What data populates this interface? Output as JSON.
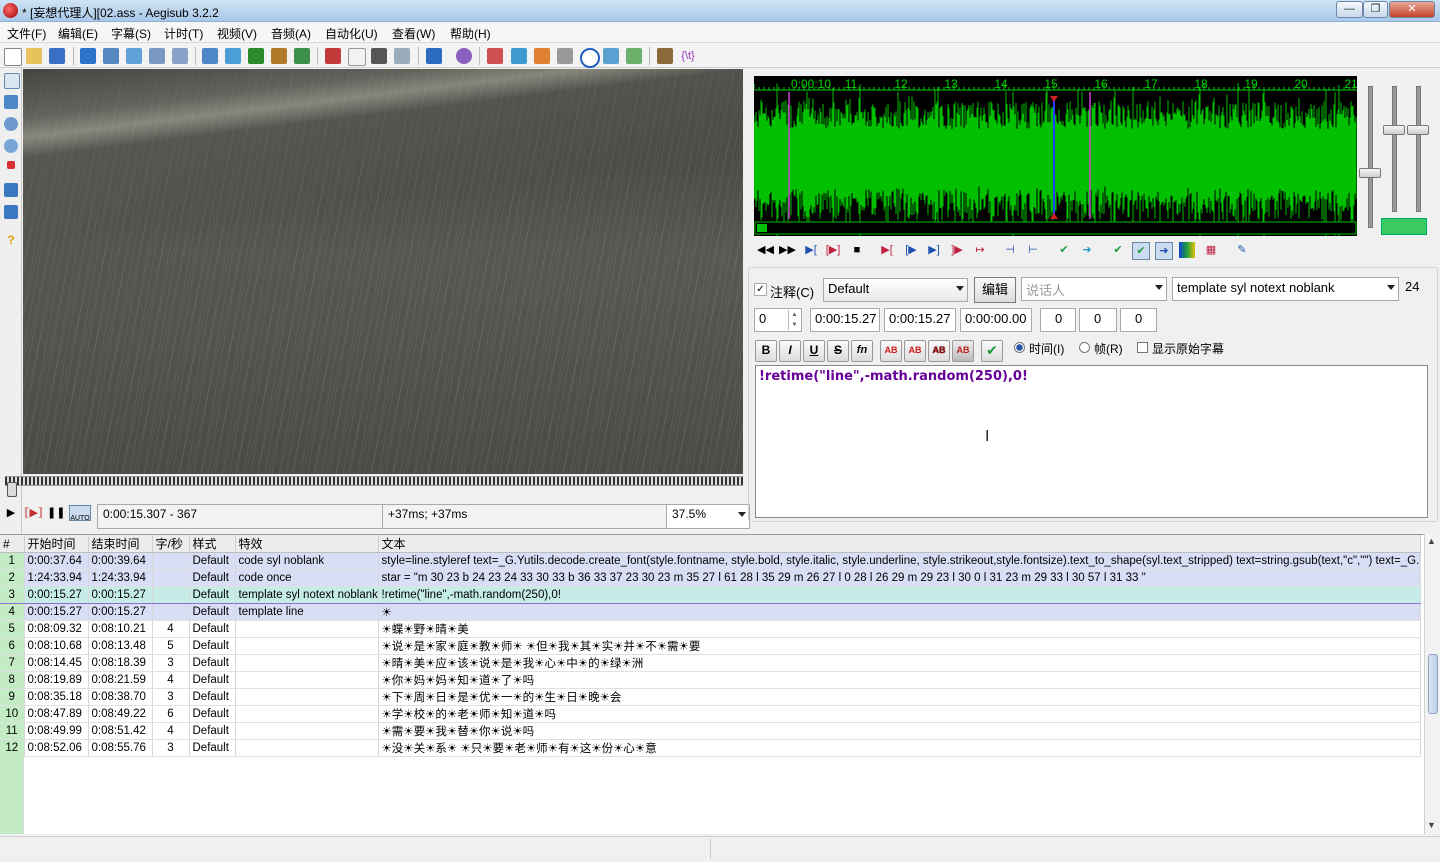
{
  "window": {
    "title": "* [妄想代理人][02.ass - Aegisub 3.2.2",
    "minimize": "—",
    "maximize": "❐",
    "close": "✕"
  },
  "menu": [
    "文件(F)",
    "编辑(E)",
    "字幕(S)",
    "计时(T)",
    "视频(V)",
    "音频(A)",
    "自动化(U)",
    "查看(W)",
    "帮助(H)"
  ],
  "video": {
    "time_frame": "0:00:15.307 - 367",
    "offset": "+37ms; +37ms",
    "zoom": "37.5%",
    "auto_label": "AUTO"
  },
  "audio": {
    "ruler_labels": [
      "0:00:10",
      "11",
      "12",
      "13",
      "14",
      "15",
      "16",
      "17",
      "18",
      "19",
      "20",
      "21"
    ]
  },
  "edit": {
    "comment_label": "注释(C)",
    "style": "Default",
    "edit_button": "编辑",
    "actor_placeholder": "说话人",
    "effect": "template syl notext noblank",
    "fontsize_value": "24",
    "layer": "0",
    "start_time": "0:00:15.27",
    "end_time": "0:00:15.27",
    "duration": "0:00:00.00",
    "margin_l": "0",
    "margin_r": "0",
    "margin_v": "0",
    "time_radio": "时间(I)",
    "frame_radio": "帧(R)",
    "show_original": "显示原始字幕",
    "text": "!retime(\"line\",-math.random(250),0!",
    "format_buttons": [
      "B",
      "I",
      "U",
      "S",
      "fn",
      "AB",
      "AB",
      "AB",
      "AB"
    ]
  },
  "grid": {
    "headers": [
      "#",
      "开始时间",
      "结束时间",
      "字/秒",
      "样式",
      "特效",
      "文本"
    ],
    "rows": [
      {
        "num": "1",
        "start": "0:00:37.64",
        "end": "0:00:39.64",
        "cps": "",
        "style": "Default",
        "effect": "code syl noblank",
        "text": "style=line.styleref text=_G.Yutils.decode.create_font(style.fontname, style.bold, style.italic, style.underline, style.strikeout,style.fontsize).text_to_shape(syl.text_stripped)  text=string.gsub(text,\"c\",\"\")  text=_G.Y",
        "kind": "comment"
      },
      {
        "num": "2",
        "start": "1:24:33.94",
        "end": "1:24:33.94",
        "cps": "",
        "style": "Default",
        "effect": "code once",
        "text": "star = \"m 30 23 b 24 23 24 33 30 33 b 36 33 37 23 30 23 m 35 27 l 61 28 l 35 29 m 26 27 l 0 28 l 26 29 m 29 23 l 30 0 l 31 23 m 29 33 l 30 57 l 31 33 \"",
        "kind": "comment"
      },
      {
        "num": "3",
        "start": "0:00:15.27",
        "end": "0:00:15.27",
        "cps": "",
        "style": "Default",
        "effect": "template syl notext noblank",
        "text": "!retime(\"line\",-math.random(250),0!",
        "kind": "active"
      },
      {
        "num": "4",
        "start": "0:00:15.27",
        "end": "0:00:15.27",
        "cps": "",
        "style": "Default",
        "effect": "template line",
        "text": "☀",
        "kind": "comment"
      },
      {
        "num": "5",
        "start": "0:08:09.32",
        "end": "0:08:10.21",
        "cps": "4",
        "style": "Default",
        "effect": "",
        "text": "☀蝶☀野☀晴☀美",
        "kind": "normal"
      },
      {
        "num": "6",
        "start": "0:08:10.68",
        "end": "0:08:13.48",
        "cps": "5",
        "style": "Default",
        "effect": "",
        "text": "☀说☀是☀家☀庭☀教☀师☀ ☀但☀我☀其☀实☀并☀不☀需☀要",
        "kind": "normal"
      },
      {
        "num": "7",
        "start": "0:08:14.45",
        "end": "0:08:18.39",
        "cps": "3",
        "style": "Default",
        "effect": "",
        "text": "☀晴☀美☀应☀该☀说☀是☀我☀心☀中☀的☀绿☀洲",
        "kind": "normal"
      },
      {
        "num": "8",
        "start": "0:08:19.89",
        "end": "0:08:21.59",
        "cps": "4",
        "style": "Default",
        "effect": "",
        "text": "☀你☀妈☀妈☀知☀道☀了☀吗",
        "kind": "normal"
      },
      {
        "num": "9",
        "start": "0:08:35.18",
        "end": "0:08:38.70",
        "cps": "3",
        "style": "Default",
        "effect": "",
        "text": "☀下☀周☀日☀是☀优☀一☀的☀生☀日☀晚☀会",
        "kind": "normal"
      },
      {
        "num": "10",
        "start": "0:08:47.89",
        "end": "0:08:49.22",
        "cps": "6",
        "style": "Default",
        "effect": "",
        "text": "☀学☀校☀的☀老☀师☀知☀道☀吗",
        "kind": "normal"
      },
      {
        "num": "11",
        "start": "0:08:49.99",
        "end": "0:08:51.42",
        "cps": "4",
        "style": "Default",
        "effect": "",
        "text": "☀需☀要☀我☀替☀你☀说☀吗",
        "kind": "normal"
      },
      {
        "num": "12",
        "start": "0:08:52.06",
        "end": "0:08:55.76",
        "cps": "3",
        "style": "Default",
        "effect": "",
        "text": "☀没☀关☀系☀ ☀只☀要☀老☀师☀有☀这☀份☀心☀意",
        "kind": "normal"
      }
    ]
  },
  "colors": {
    "waveform": "#00c000",
    "grid_comment_bg": "#d8def5",
    "grid_active_bg": "#c6ece8",
    "line_number_bg": "#c4ecc4",
    "editor_text": "#660099"
  }
}
